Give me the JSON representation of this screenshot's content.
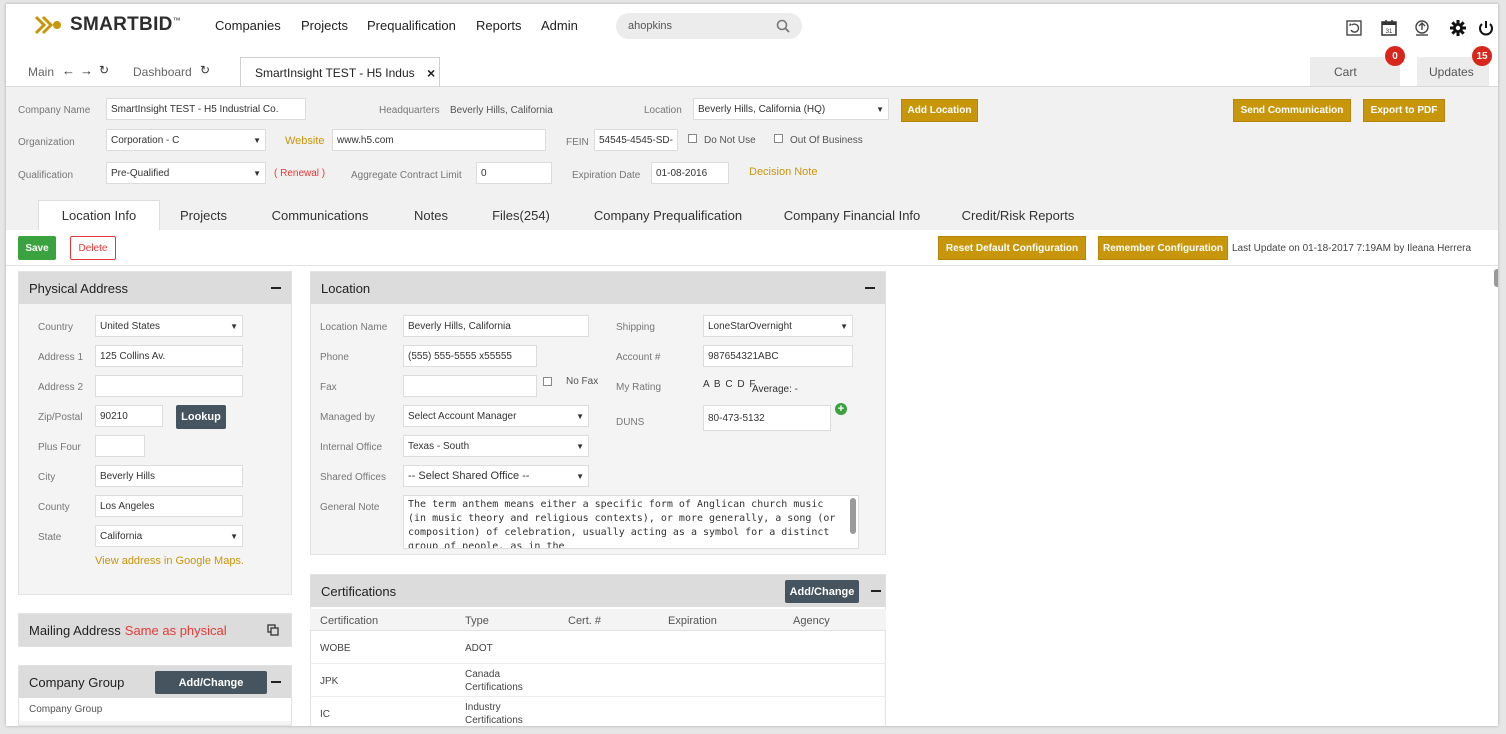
{
  "header": {
    "logo_text": "SMARTBID",
    "logo_tm": "™",
    "nav": [
      "Companies",
      "Projects",
      "Prequalification",
      "Reports",
      "Admin"
    ],
    "search_value": "ahopkins",
    "icons": [
      "refresh-report-icon",
      "calendar-icon",
      "upload-icon",
      "gear-icon",
      "power-icon"
    ],
    "calendar_day": "31"
  },
  "tabs": {
    "main_label": "Main",
    "dashboard_label": "Dashboard",
    "doc_tab_label": "SmartInsight TEST - H5 Indus",
    "close": "×",
    "cart_label": "Cart",
    "cart_count": "0",
    "updates_label": "Updates",
    "updates_count": "15"
  },
  "company": {
    "name_label": "Company Name",
    "name_value": "SmartInsight TEST - H5 Industrial Co.",
    "hq_label": "Headquarters",
    "hq_value": "Beverly Hills, California",
    "location_label": "Location",
    "location_value": "Beverly Hills, California (HQ)",
    "add_location": "Add Location",
    "send_communication": "Send Communication",
    "export_pdf": "Export to PDF",
    "org_label": "Organization",
    "org_value": "Corporation - C",
    "website_label": "Website",
    "website_value": "www.h5.com",
    "fein_label": "FEIN",
    "fein_value": "54545-4545-SD-",
    "do_not_use": "Do Not Use",
    "out_of_business": "Out Of Business",
    "qual_label": "Qualification",
    "qual_value": "Pre-Qualified",
    "renewal": "( Renewal )",
    "agg_label": "Aggregate Contract Limit",
    "agg_value": "0",
    "exp_label": "Expiration Date",
    "exp_value": "01-08-2016",
    "decision_note": "Decision Note"
  },
  "subtabs": [
    "Location Info",
    "Projects",
    "Communications",
    "Notes",
    "Files(254)",
    "Company Prequalification",
    "Company Financial Info",
    "Credit/Risk Reports"
  ],
  "toolbar": {
    "save": "Save",
    "delete": "Delete",
    "reset": "Reset Default Configuration",
    "remember": "Remember Configuration",
    "last_update": "Last Update on 01-18-2017 7:19AM by Ileana Herrera"
  },
  "physical": {
    "title": "Physical Address",
    "country_label": "Country",
    "country_value": "United States",
    "address1_label": "Address 1",
    "address1_value": "125 Collins Av.",
    "address2_label": "Address 2",
    "address2_value": "",
    "zip_label": "Zip/Postal",
    "zip_value": "90210",
    "lookup": "Lookup",
    "plusfour_label": "Plus Four",
    "plusfour_value": "",
    "city_label": "City",
    "city_value": "Beverly Hills",
    "county_label": "County",
    "county_value": "Los Angeles",
    "state_label": "State",
    "state_value": "California",
    "maps_link": "View address in Google Maps."
  },
  "mailing": {
    "title": "Mailing Address",
    "same": "Same as physical"
  },
  "group": {
    "title": "Company Group",
    "button": "Add/Change",
    "col": "Company Group"
  },
  "location": {
    "title": "Location",
    "name_label": "Location Name",
    "name_value": "Beverly Hills, California",
    "phone_label": "Phone",
    "phone_value": "(555) 555-5555 x55555",
    "fax_label": "Fax",
    "fax_value": "",
    "no_fax": "No Fax",
    "managed_label": "Managed by",
    "managed_value": "Select Account Manager",
    "internal_label": "Internal Office",
    "internal_value": "Texas - South",
    "shared_label": "Shared Offices",
    "shared_value": "-- Select Shared Office --",
    "note_label": "General Note",
    "note_value": "The term anthem means either a specific form of Anglican church music (in music theory and religious contexts), or more generally, a song (or composition) of celebration, usually acting as a symbol for a distinct group of people, as in the",
    "shipping_label": "Shipping",
    "shipping_value": "LoneStarOvernight",
    "account_label": "Account #",
    "account_value": "987654321ABC",
    "rating_label": "My Rating",
    "rating_value": "A B C D F",
    "average": "Average: -",
    "duns_label": "DUNS",
    "duns_value": "80-473-5132"
  },
  "certifications": {
    "title": "Certifications",
    "button": "Add/Change",
    "columns": [
      "Certification",
      "Type",
      "Cert. #",
      "Expiration",
      "Agency"
    ],
    "rows": [
      [
        "WOBE",
        "ADOT",
        "",
        "",
        ""
      ],
      [
        "JPK",
        "Canada Certifications",
        "",
        "",
        ""
      ],
      [
        "IC",
        "Industry Certifications",
        "",
        "",
        ""
      ]
    ]
  },
  "colors": {
    "gold": "#c8960a",
    "dark_button": "#45545e",
    "badge": "#d9261c",
    "save_green": "#3aa23e",
    "link_red": "#e53935"
  }
}
